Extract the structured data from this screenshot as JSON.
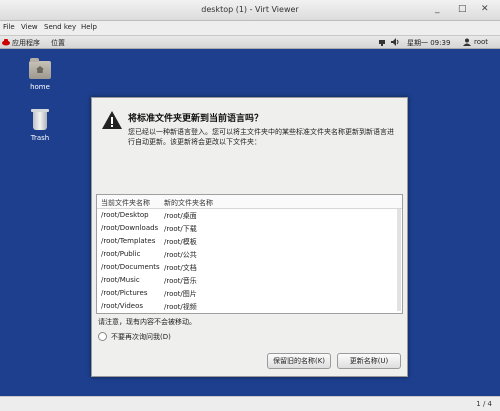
{
  "window": {
    "title": "desktop (1) - Virt Viewer",
    "controls": {
      "minimize": "_",
      "maximize": "□",
      "close": "✕"
    }
  },
  "menubar": {
    "items": [
      "File",
      "View",
      "Send key",
      "Help"
    ]
  },
  "panel": {
    "apps": "应用程序",
    "places": "位置",
    "clock": "星期一 09:39",
    "user": "root"
  },
  "desktop": {
    "icons": [
      {
        "label": "home",
        "icon": "home-folder-icon"
      },
      {
        "label": "Trash",
        "icon": "trash-icon"
      }
    ]
  },
  "dialog": {
    "title": "将标准文件夹更新到当前语言吗？",
    "description": "您已经以一种新语言登入。您可以将主文件夹中的某些标准文件夹名称更新到新语言进行自动更新。该更新将会更改以下文件夹：",
    "table": {
      "col_current": "当前文件夹名称",
      "col_new": "新的文件夹名称",
      "rows": [
        {
          "current": "/root/Desktop",
          "new": "/root/桌面"
        },
        {
          "current": "/root/Downloads",
          "new": "/root/下载"
        },
        {
          "current": "/root/Templates",
          "new": "/root/模板"
        },
        {
          "current": "/root/Public",
          "new": "/root/公共"
        },
        {
          "current": "/root/Documents",
          "new": "/root/文档"
        },
        {
          "current": "/root/Music",
          "new": "/root/音乐"
        },
        {
          "current": "/root/Pictures",
          "new": "/root/图片"
        },
        {
          "current": "/root/Videos",
          "new": "/root/视频"
        }
      ]
    },
    "note": "请注意，现有内容不会被移动。",
    "dont_ask": "不要再次询问我(D)",
    "keep_button": "保留旧的名称(K)",
    "update_button": "更新名称(U)"
  },
  "status": {
    "page": "1 / 4"
  }
}
